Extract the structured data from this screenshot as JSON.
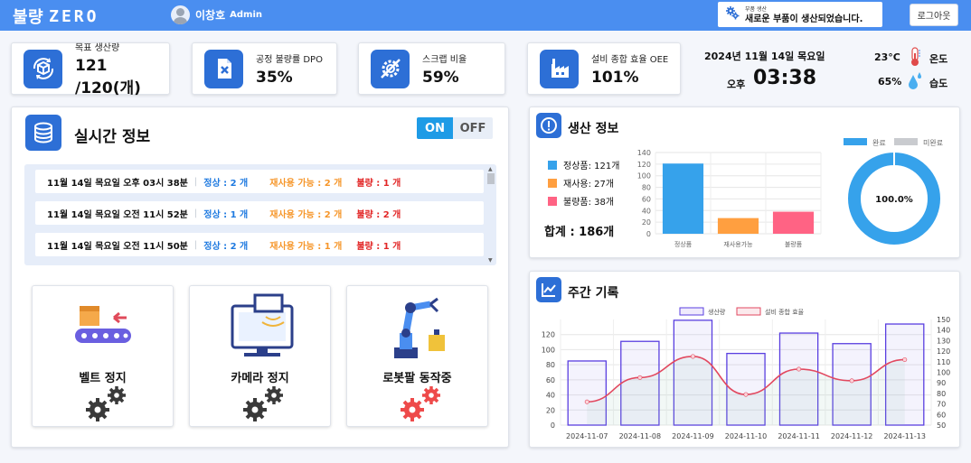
{
  "header": {
    "logo_text": "불량",
    "logo_zero": "ZERO",
    "user_name": "이창호",
    "user_role": "Admin",
    "notice_title": "부품 생산",
    "notice_message": "새로운 부품이 생산되었습니다.",
    "logout_label": "로그아웃",
    "bar_color": "#4a8ef0"
  },
  "kpis": [
    {
      "label": "목표 생산량",
      "value": "121 /120(개)",
      "icon": "cube-cycle-icon"
    },
    {
      "label": "공정 불량률  DPO",
      "value": "35%",
      "icon": "file-x-icon"
    },
    {
      "label": "스크랩 비율",
      "value": "59%",
      "icon": "crossed-gear-icon"
    },
    {
      "label": "설비 종합 효율  OEE",
      "value": "101%",
      "icon": "factory-icon"
    }
  ],
  "clock": {
    "date": "2024년 11월 14일 목요일",
    "ampm": "오후",
    "time": "03:38",
    "temperature": "23°C",
    "temperature_label": "온도",
    "humidity": "65%",
    "humidity_label": "습도"
  },
  "realtime": {
    "title": "실시간 정보",
    "toggle_on": "ON",
    "toggle_off": "OFF",
    "rows": [
      {
        "datetime": "11월 14일 목요일   오후 03시 38분",
        "normal": "정상 : 2 개",
        "reuse": "재사용 가능 : 2 개",
        "defect": "불량 : 1 개"
      },
      {
        "datetime": "11월 14일 목요일   오전 11시 52분",
        "normal": "정상 : 1 개",
        "reuse": "재사용 가능 : 2 개",
        "defect": "불량 : 2 개"
      },
      {
        "datetime": "11월 14일 목요일   오전 11시 50분",
        "normal": "정상 : 2 개",
        "reuse": "재사용 가능 : 1 개",
        "defect": "불량 : 1 개"
      }
    ],
    "machines": [
      {
        "label": "벨트 정지",
        "gear_color": "#3a3a3a"
      },
      {
        "label": "카메라 정지",
        "gear_color": "#3a3a3a"
      },
      {
        "label": "로봇팔 동작중",
        "gear_color": "#ee4a4a"
      }
    ]
  },
  "production": {
    "title": "생산 정보",
    "legend": [
      {
        "label": "정상품: 121개",
        "color": "#36a2eb"
      },
      {
        "label": "재사용: 27개",
        "color": "#ff9f40"
      },
      {
        "label": "불량품: 38개",
        "color": "#ff6384"
      }
    ],
    "total": "합계 : 186개",
    "donut_legend_done": "완료",
    "donut_legend_undone": "미완료",
    "donut_label": "100.0%"
  },
  "weekly": {
    "title": "주간 기록",
    "legend_production": "생산량",
    "legend_oee": "설비 종합 효율"
  },
  "chart_data": [
    {
      "type": "bar",
      "categories": [
        "정상품",
        "재사용가능",
        "불량품"
      ],
      "values": [
        121,
        27,
        38
      ],
      "colors": [
        "#36a2eb",
        "#ff9f40",
        "#ff6384"
      ],
      "ylim": [
        0,
        140
      ],
      "yticks": [
        0,
        20,
        40,
        60,
        80,
        100,
        120,
        140
      ],
      "grid": true
    },
    {
      "type": "pie",
      "categories": [
        "완료",
        "미완료"
      ],
      "values": [
        100,
        0
      ],
      "colors": [
        "#36a2eb",
        "#c9cbcf"
      ]
    },
    {
      "type": "bar",
      "categories": [
        "2024-11-07",
        "2024-11-08",
        "2024-11-09",
        "2024-11-10",
        "2024-11-11",
        "2024-11-12",
        "2024-11-13"
      ],
      "series": [
        {
          "name": "생산량",
          "type": "bar",
          "axis": "left",
          "values": [
            85,
            111,
            139,
            95,
            122,
            108,
            134
          ],
          "color": "#5a3fe0"
        },
        {
          "name": "설비 종합 효율",
          "type": "line",
          "axis": "right",
          "values": [
            72,
            95,
            115,
            79,
            103,
            92,
            112
          ],
          "color": "#e2485f"
        }
      ],
      "ylim_left": [
        0,
        140
      ],
      "yticks_left": [
        0,
        20,
        40,
        60,
        80,
        100,
        120
      ],
      "ylim_right": [
        50,
        150
      ],
      "yticks_right": [
        50,
        60,
        70,
        80,
        90,
        100,
        110,
        120,
        130,
        140,
        150
      ],
      "legend_position": "top",
      "grid": true
    }
  ]
}
